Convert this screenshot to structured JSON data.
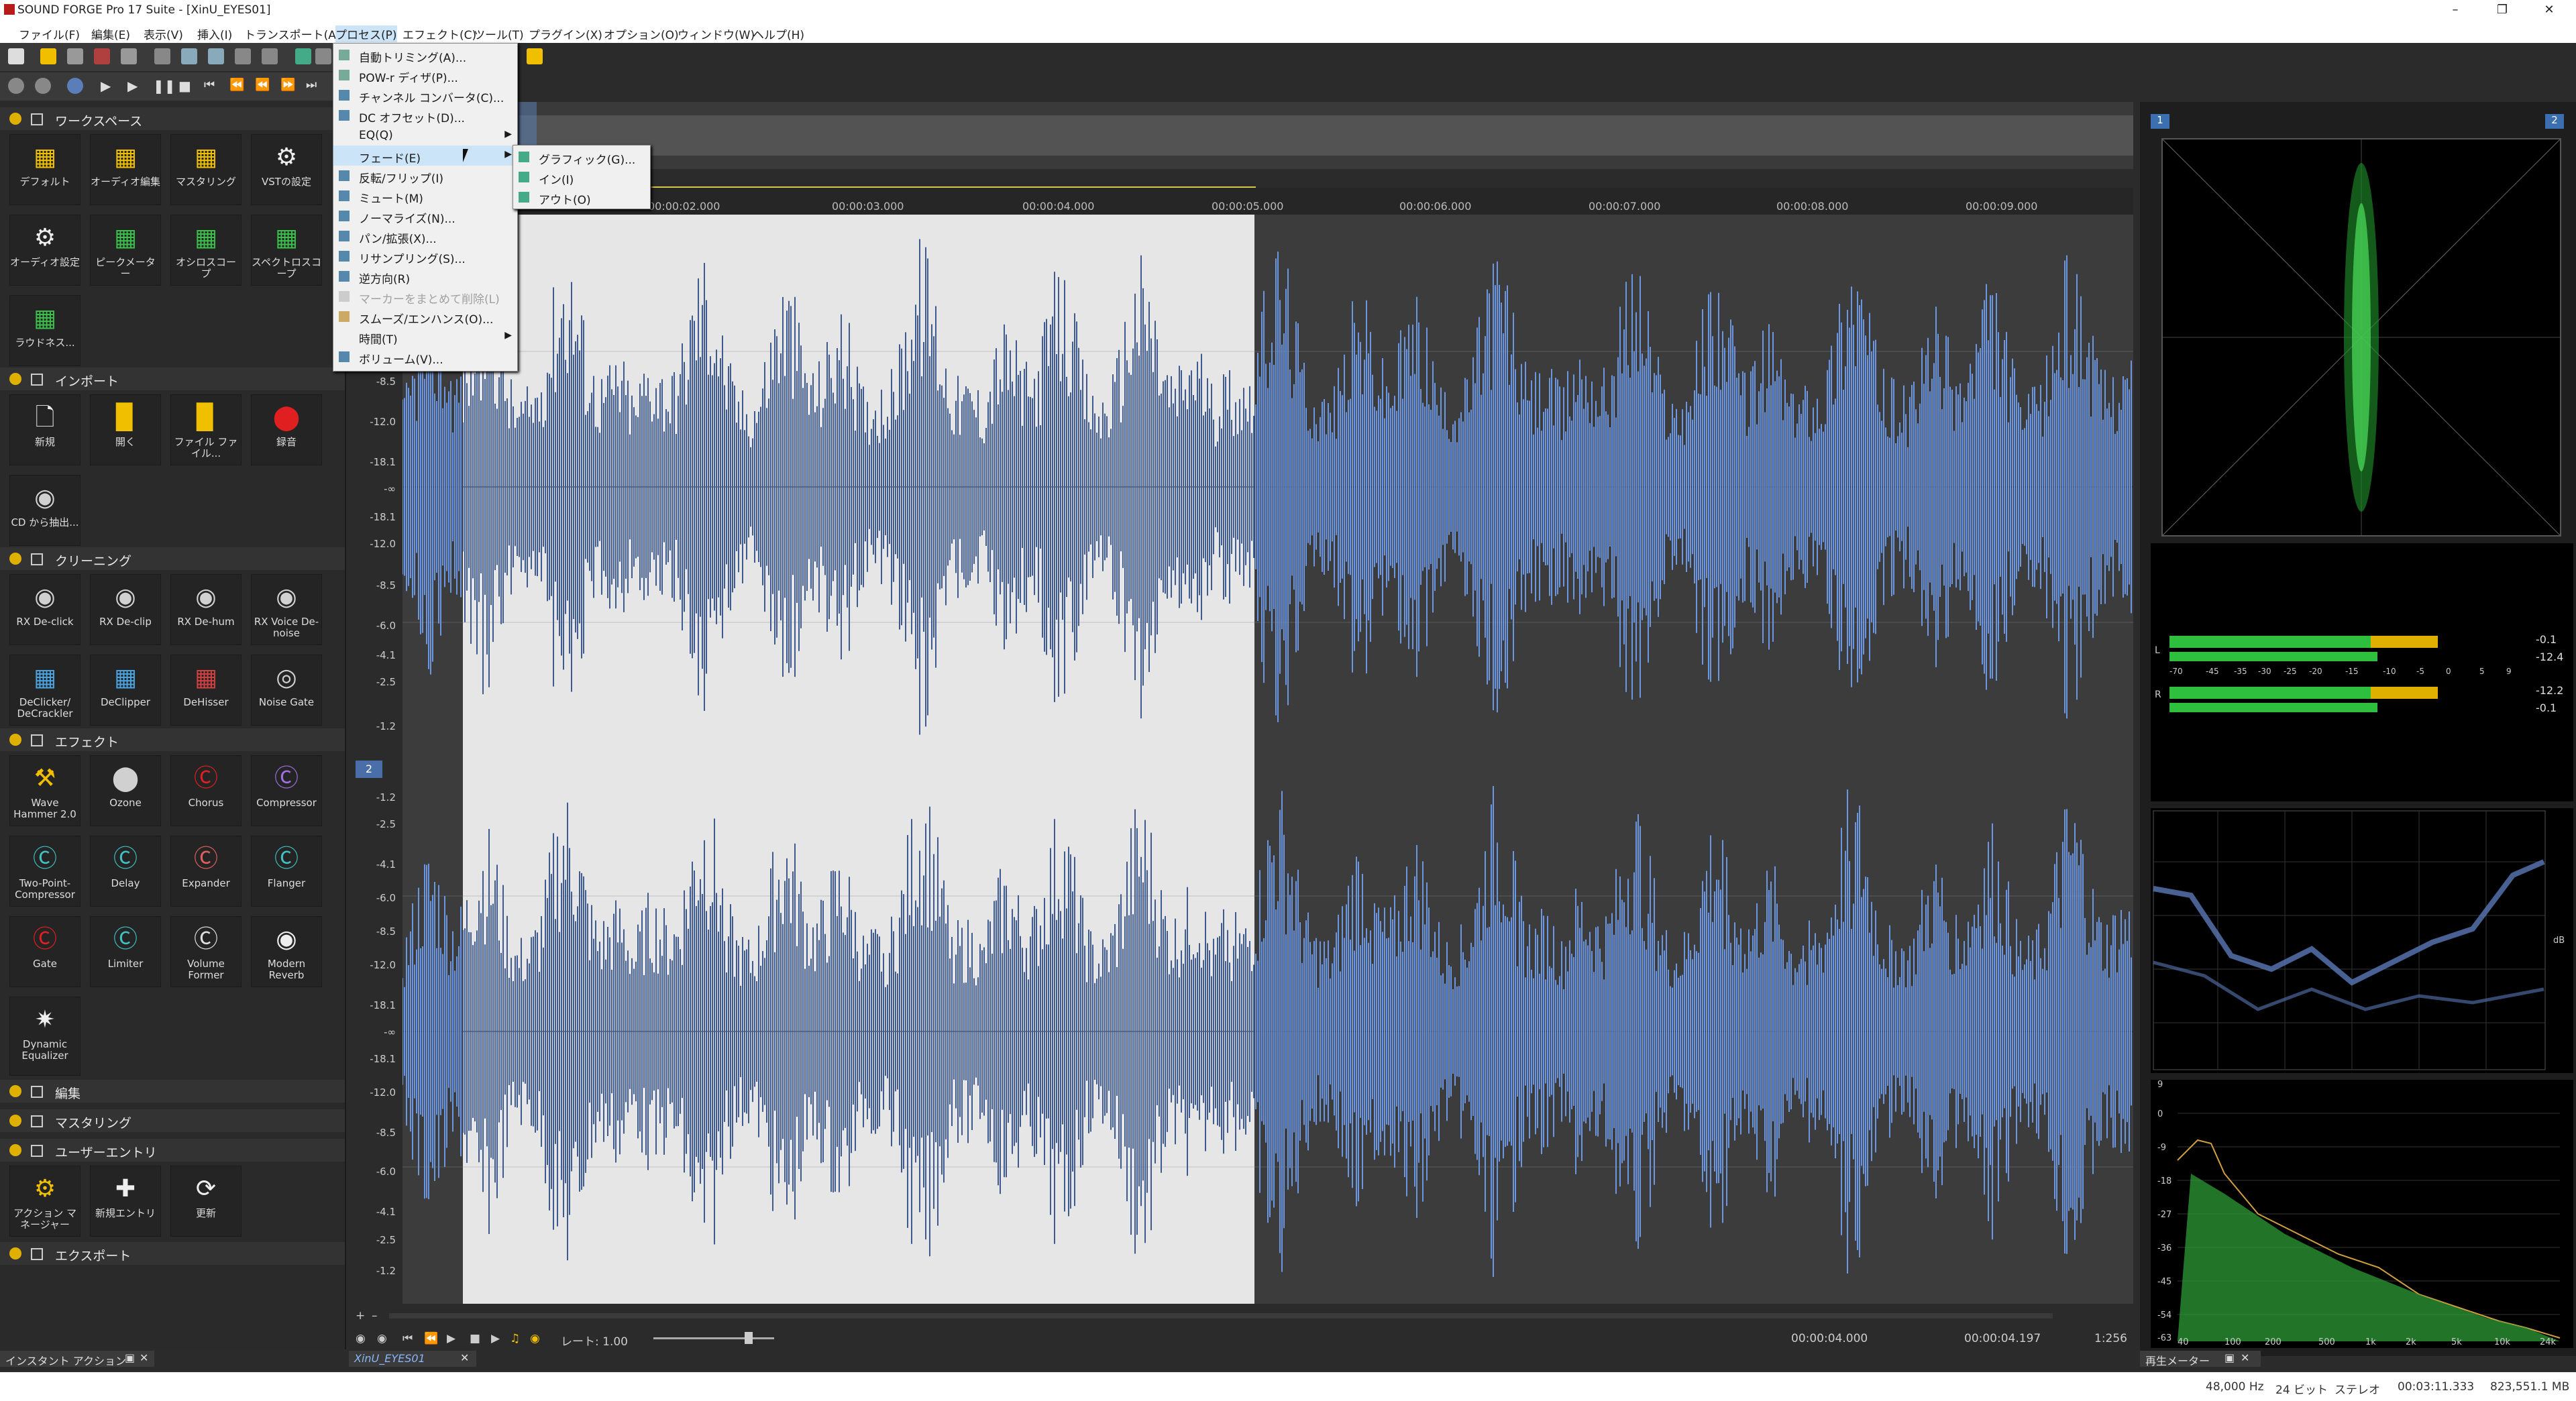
{
  "window": {
    "title": "SOUND FORGE Pro 17 Suite - [XinU_EYES01]"
  },
  "menubar": {
    "items": [
      "ファイル(F)",
      "編集(E)",
      "表示(V)",
      "挿入(I)",
      "トランスポート(A)",
      "プロセス(P)",
      "エフェクト(C)",
      "ツール(T)",
      "プラグイン(X)",
      "オプション(O)",
      "ウィンドウ(W)",
      "ヘルプ(H)"
    ]
  },
  "process_menu": {
    "items": [
      {
        "label": "自動トリミング(A)...",
        "submenu": false,
        "disabled": false
      },
      {
        "label": "POW-r ディザ(P)...",
        "submenu": false,
        "disabled": false
      },
      {
        "label": "チャンネル コンバータ(C)...",
        "submenu": false,
        "disabled": false
      },
      {
        "label": "DC オフセット(D)...",
        "submenu": false,
        "disabled": false
      },
      {
        "label": "EQ(Q)",
        "submenu": true,
        "disabled": false
      },
      {
        "label": "フェード(E)",
        "submenu": true,
        "disabled": false,
        "highlighted": true
      },
      {
        "label": "反転/フリップ(I)",
        "submenu": false,
        "disabled": false
      },
      {
        "label": "ミュート(M)",
        "submenu": false,
        "disabled": false
      },
      {
        "label": "ノーマライズ(N)...",
        "submenu": false,
        "disabled": false
      },
      {
        "label": "パン/拡張(X)...",
        "submenu": false,
        "disabled": false
      },
      {
        "label": "リサンプリング(S)...",
        "submenu": false,
        "disabled": false
      },
      {
        "label": "逆方向(R)",
        "submenu": false,
        "disabled": false
      },
      {
        "label": "マーカーをまとめて削除(L)",
        "submenu": false,
        "disabled": true
      },
      {
        "label": "スムーズ/エンハンス(O)...",
        "submenu": false,
        "disabled": false
      },
      {
        "label": "時間(T)",
        "submenu": true,
        "disabled": false
      },
      {
        "label": "ボリューム(V)...",
        "submenu": false,
        "disabled": false
      }
    ]
  },
  "fade_submenu": {
    "items": [
      "グラフィック(G)...",
      "イン(I)",
      "アウト(O)"
    ]
  },
  "left_panel": {
    "sections": {
      "workspace": "ワークスペース",
      "import": "インポート",
      "cleaning": "クリーニング",
      "effects": "エフェクト",
      "edit": "編集",
      "mastering": "マスタリング",
      "user_entry": "ユーザーエントリ",
      "export": "エクスポート"
    },
    "workspace_tiles": [
      "デフォルト",
      "オーディオ編集",
      "マスタリング",
      "VSTの設定",
      "オーディオ設定",
      "ピークメーター",
      "オシロスコープ",
      "スペクトロスコープ",
      "ラウドネス..."
    ],
    "import_tiles": [
      "新規",
      "開く",
      "ファイル ファイル...",
      "録音",
      "CD から抽出..."
    ],
    "cleaning_tiles": [
      "RX De-click",
      "RX De-clip",
      "RX De-hum",
      "RX Voice De-noise",
      "DeClicker/ DeCrackler",
      "DeClipper",
      "DeHisser",
      "Noise Gate"
    ],
    "effect_tiles": [
      "Wave Hammer 2.0",
      "Ozone",
      "Chorus",
      "Compressor",
      "Two-Point-Compressor",
      "Delay",
      "Expander",
      "Flanger",
      "Gate",
      "Limiter",
      "Volume Former",
      "Modern Reverb",
      "Dynamic Equalizer"
    ],
    "user_tiles": [
      "アクション マネージャー",
      "新規エントリ",
      "更新"
    ],
    "bottom_tab": "インスタント アクション"
  },
  "ruler": {
    "labels": [
      "00:00:02.000",
      "00:00:03.000",
      "00:00:04.000",
      "00:00:05.000",
      "00:00:06.000",
      "00:00:07.000",
      "00:00:08.000",
      "00:00:09.000"
    ]
  },
  "db_axis": {
    "labels": [
      "-8.5",
      "-12.0",
      "-18.1",
      "-∞",
      "-18.1",
      "-12.0",
      "-8.5",
      "-6.0",
      "-4.1",
      "-2.5",
      "-1.2"
    ]
  },
  "db_axis2": {
    "labels": [
      "-1.2",
      "-2.5",
      "-4.1",
      "-6.0",
      "-8.5",
      "-12.0",
      "-18.1",
      "-∞",
      "-18.1",
      "-12.0",
      "-8.5",
      "-6.0",
      "-4.1",
      "-2.5",
      "-1.2"
    ]
  },
  "track2_number": "2",
  "transport": {
    "rate_label": "レート: 1.00",
    "position": "00:00:04.000",
    "selection_end": "00:00:04.197",
    "zoom": "1:256"
  },
  "doc_tab": "XinU_EYES01",
  "meters": {
    "panel_label": "再生メーター",
    "vector_ch_left": "1",
    "vector_ch_right": "2",
    "level_values": [
      "-0.1",
      "-12.4",
      "-12.2",
      "-0.1"
    ],
    "level_scale": [
      "-70",
      "-45",
      "-35",
      "-30",
      "-25",
      "-20",
      "-15",
      "-10",
      "-5",
      "0",
      "5",
      "9"
    ],
    "channels": [
      "L",
      "R"
    ],
    "graph_label": "dB",
    "spectrum_y": [
      "9",
      "0",
      "-9",
      "-18",
      "-27",
      "-36",
      "-45",
      "-54",
      "-63"
    ],
    "spectrum_x": [
      "40",
      "100",
      "200",
      "500",
      "1k",
      "2k",
      "5k",
      "10k",
      "24k"
    ]
  },
  "status": {
    "rate": "48,000 Hz",
    "bits": "24 ビット",
    "channels": "ステレオ",
    "length": "00:03:11.333",
    "size": "823,551.1 MB"
  },
  "colors": {
    "wave": "#6d96e0",
    "wave_dark": "#3f5a8f",
    "accent": "#f0c000",
    "meter_green": "#2fbf3f",
    "meter_yellow": "#e0b000"
  }
}
